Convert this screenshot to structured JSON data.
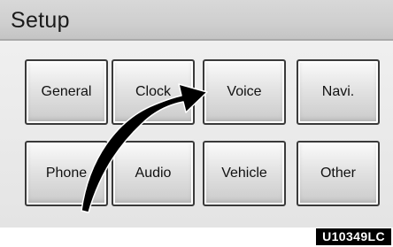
{
  "header": {
    "title": "Setup"
  },
  "buttons": {
    "general": "General",
    "clock": "Clock",
    "voice": "Voice",
    "navi": "Navi.",
    "phone": "Phone",
    "audio": "Audio",
    "vehicle": "Vehicle",
    "other": "Other"
  },
  "figure_code": "U10349LC",
  "icons": {
    "arrow": "curved-arrow-icon"
  },
  "colors": {
    "title_bar": "#cfcfcf",
    "button_border": "#3a3a3a",
    "arrow": "#000000"
  }
}
